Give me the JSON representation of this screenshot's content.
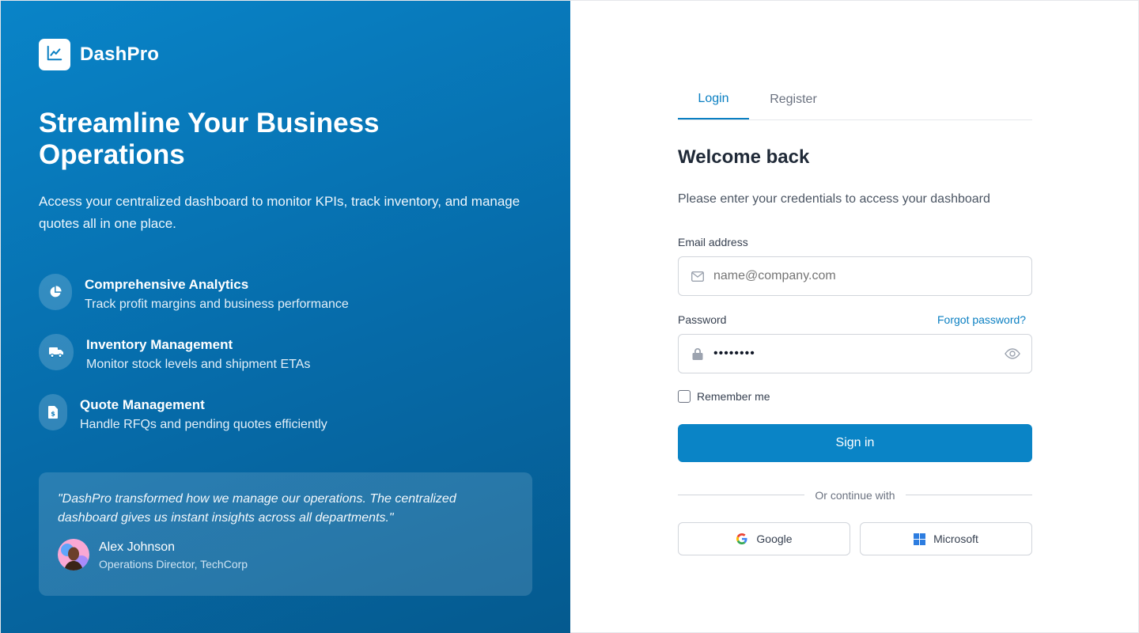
{
  "brand": {
    "name": "DashPro",
    "logo_icon": "line-chart-icon"
  },
  "hero": {
    "title": "Streamline Your Business Operations",
    "subtitle": "Access your centralized dashboard to monitor KPIs, track inventory, and manage quotes all in one place."
  },
  "features": [
    {
      "icon": "pie-chart-icon",
      "title": "Comprehensive Analytics",
      "description": "Track profit margins and business performance"
    },
    {
      "icon": "truck-icon",
      "title": "Inventory Management",
      "description": "Monitor stock levels and shipment ETAs"
    },
    {
      "icon": "invoice-dollar-icon",
      "title": "Quote Management",
      "description": "Handle RFQs and pending quotes efficiently"
    }
  ],
  "testimonial": {
    "quote": "\"DashPro transformed how we manage our operations. The centralized dashboard gives us instant insights across all departments.\"",
    "name": "Alex Johnson",
    "role": "Operations Director, TechCorp"
  },
  "tabs": {
    "login": "Login",
    "register": "Register",
    "active": "Login"
  },
  "form": {
    "heading": "Welcome back",
    "subheading": "Please enter your credentials to access your dashboard",
    "email_label": "Email address",
    "email_placeholder": "name@company.com",
    "email_value": "",
    "password_label": "Password",
    "password_value": "••••••••",
    "forgot_label": "Forgot password?",
    "remember_label": "Remember me",
    "remember_checked": false,
    "submit_label": "Sign in",
    "divider_text": "Or continue with",
    "google_label": "Google",
    "microsoft_label": "Microsoft"
  },
  "colors": {
    "primary": "#0a84c6",
    "link": "#0a7fc2",
    "panel_gradient_start": "#0984c8",
    "panel_gradient_end": "#055a8f"
  }
}
